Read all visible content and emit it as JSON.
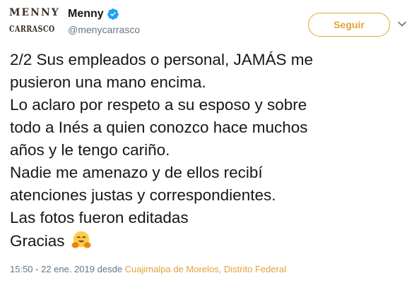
{
  "header": {
    "avatar_text_line1": "MENNY",
    "avatar_text_line2": "CARRASCO",
    "display_name": "Menny",
    "handle": "@menycarrasco",
    "verified": true,
    "follow_label": "Seguir"
  },
  "tweet": {
    "lines": [
      "2/2 Sus empleados o personal, JAMÁS me",
      "pusieron una mano encima.",
      "Lo aclaro por respeto a su esposo y sobre",
      "todo a Inés a quien conozco hace muchos",
      "años y le tengo cariño.",
      "Nadie me amenazo y de ellos recibí",
      "atenciones justas y correspondientes.",
      "Las fotos fueron editadas",
      "Gracias"
    ],
    "emoji": "hugging-face-icon"
  },
  "meta": {
    "timestamp": "15:50 - 22 ene. 2019",
    "from_label": "desde",
    "location": "Cuajimalpa de Morelos, Distrito Federal"
  },
  "colors": {
    "accent": "#e1a339",
    "text": "#14171a",
    "secondary": "#657786",
    "verified": "#1da1f2"
  }
}
